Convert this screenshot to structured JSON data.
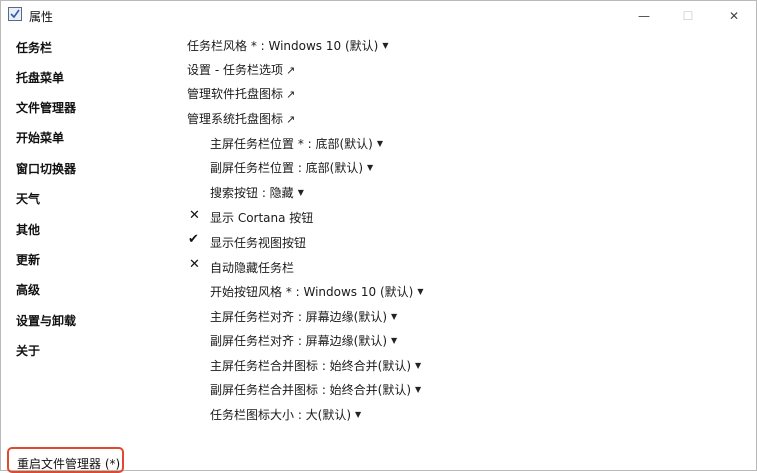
{
  "window": {
    "title": "属性",
    "minimize_label": "—",
    "maximize_label": "☐",
    "close_label": "✕"
  },
  "sidebar": {
    "items": [
      {
        "label": "任务栏"
      },
      {
        "label": "托盘菜单"
      },
      {
        "label": "文件管理器"
      },
      {
        "label": "开始菜单"
      },
      {
        "label": "窗口切换器"
      },
      {
        "label": "天气"
      },
      {
        "label": "其他"
      },
      {
        "label": "更新"
      },
      {
        "label": "高级"
      },
      {
        "label": "设置与卸载"
      },
      {
        "label": "关于"
      }
    ],
    "restart_label": "重启文件管理器 (*)"
  },
  "settings": [
    {
      "label": "任务栏风格 * : Windows 10 (默认)",
      "kind": "dropdown",
      "indent": false
    },
    {
      "label": "设置 - 任务栏选项",
      "kind": "link",
      "indent": false
    },
    {
      "label": "管理软件托盘图标",
      "kind": "link",
      "indent": false
    },
    {
      "label": "管理系统托盘图标",
      "kind": "link",
      "indent": false
    },
    {
      "label": "主屏任务栏位置 * : 底部(默认)",
      "kind": "dropdown",
      "indent": true
    },
    {
      "label": "副屏任务栏位置 : 底部(默认)",
      "kind": "dropdown",
      "indent": true
    },
    {
      "label": "搜索按钮 : 隐藏",
      "kind": "dropdown",
      "indent": true
    },
    {
      "label": "显示 Cortana 按钮",
      "kind": "toggle",
      "checked": false,
      "indent": true
    },
    {
      "label": "显示任务视图按钮",
      "kind": "toggle",
      "checked": true,
      "indent": true
    },
    {
      "label": "自动隐藏任务栏",
      "kind": "toggle",
      "checked": false,
      "indent": true
    },
    {
      "label": "开始按钮风格 * : Windows 10 (默认)",
      "kind": "dropdown",
      "indent": true
    },
    {
      "label": "主屏任务栏对齐 : 屏幕边缘(默认)",
      "kind": "dropdown",
      "indent": true
    },
    {
      "label": "副屏任务栏对齐 : 屏幕边缘(默认)",
      "kind": "dropdown",
      "indent": true
    },
    {
      "label": "主屏任务栏合并图标 : 始终合并(默认)",
      "kind": "dropdown",
      "indent": true
    },
    {
      "label": "副屏任务栏合并图标 : 始终合并(默认)",
      "kind": "dropdown",
      "indent": true
    },
    {
      "label": "任务栏图标大小 : 大(默认)",
      "kind": "dropdown",
      "indent": true
    }
  ],
  "icons": {
    "dropdown": "caret-down",
    "link": "external-link-arrow",
    "checked": "checkmark",
    "unchecked": "cross-mark"
  },
  "glyphs": {
    "caret": "▼",
    "link": "↗",
    "check": "✔",
    "cross": "✕"
  },
  "colors": {
    "restart_highlight": "#e0482f"
  }
}
